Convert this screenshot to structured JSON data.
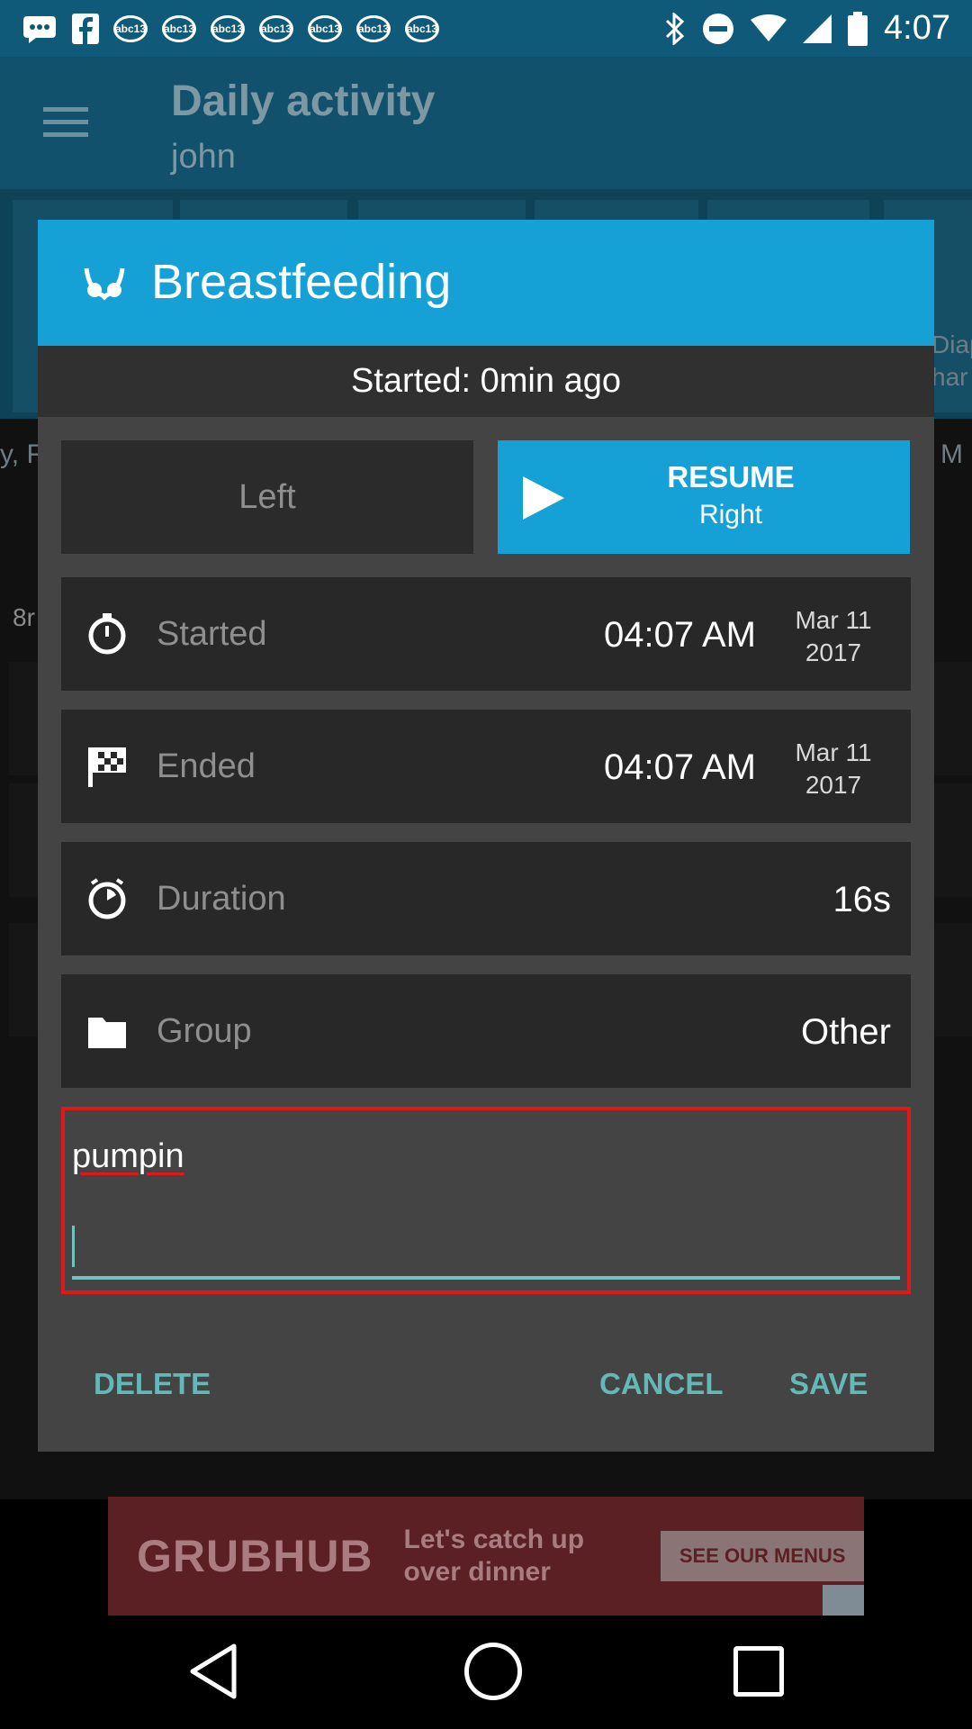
{
  "status_bar": {
    "time": "4:07",
    "notification_icons": [
      "messages-icon",
      "facebook-icon",
      "abc13-icon",
      "abc13-icon",
      "abc13-icon",
      "abc13-icon",
      "abc13-icon",
      "abc13-icon",
      "abc13-icon"
    ],
    "badge_text": "abc13"
  },
  "app_bar": {
    "title": "Daily activity",
    "subtitle": "john"
  },
  "background_fragments": {
    "left_text": "y, F",
    "right_text": "M",
    "left_small": "8r",
    "right_tab": "Diap\nhar"
  },
  "dialog": {
    "title": "Breastfeeding",
    "title_icon": "breastfeeding-icon",
    "status_text": "Started: 0min ago",
    "left_button": "Left",
    "right_button": {
      "action": "RESUME",
      "side": "Right"
    },
    "rows": {
      "started": {
        "label": "Started",
        "time": "04:07 AM",
        "date_line1": "Mar 11",
        "date_line2": "2017"
      },
      "ended": {
        "label": "Ended",
        "time": "04:07 AM",
        "date_line1": "Mar 11",
        "date_line2": "2017"
      },
      "duration": {
        "label": "Duration",
        "value": "16s"
      },
      "group": {
        "label": "Group",
        "value": "Other"
      }
    },
    "notes": {
      "value": "pumpin"
    },
    "buttons": {
      "delete": "DELETE",
      "cancel": "CANCEL",
      "save": "SAVE"
    }
  },
  "ad": {
    "brand": "GRUBHUB",
    "tagline": "Let's catch up over dinner",
    "cta": "SEE OUR MENUS"
  },
  "colors": {
    "accent": "#16a1d6",
    "action_text": "#63b9b6",
    "highlight_border": "#e01818"
  }
}
